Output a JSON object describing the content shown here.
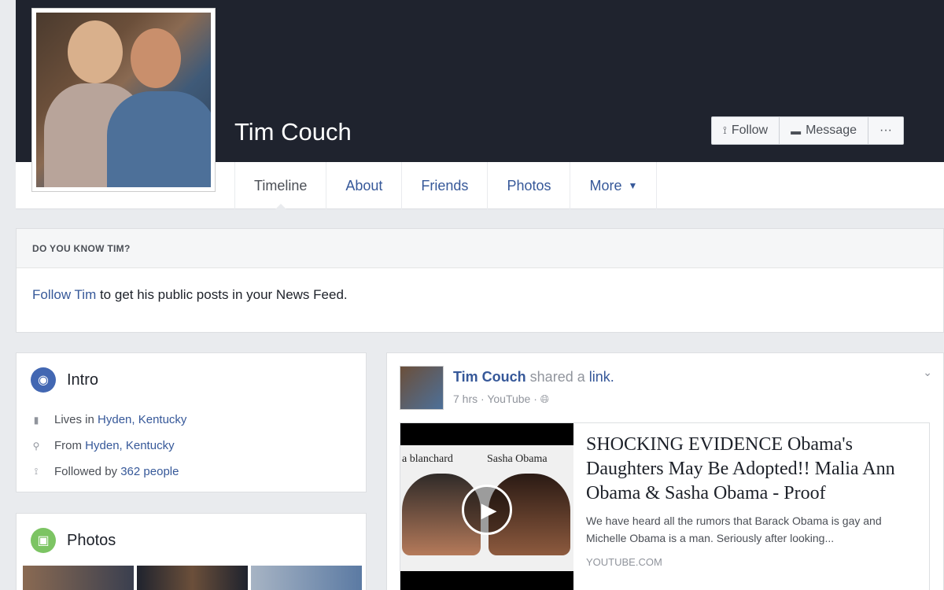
{
  "profile": {
    "name": "Tim Couch"
  },
  "cover_actions": {
    "follow": "Follow",
    "message": "Message",
    "more": "···"
  },
  "nav_tabs": [
    {
      "label": "Timeline"
    },
    {
      "label": "About"
    },
    {
      "label": "Friends"
    },
    {
      "label": "Photos"
    },
    {
      "label": "More"
    }
  ],
  "know_box": {
    "heading": "DO YOU KNOW TIM?",
    "follow_link": "Follow Tim",
    "text": " to get his public posts in your News Feed."
  },
  "intro": {
    "title": "Intro",
    "lives_prefix": "Lives in ",
    "lives_place": "Hyden, Kentucky",
    "from_prefix": "From ",
    "from_place": "Hyden, Kentucky",
    "followed_prefix": "Followed by ",
    "followed_count": "362 people"
  },
  "photos_card": {
    "title": "Photos"
  },
  "post": {
    "author": "Tim Couch",
    "action": " shared a ",
    "object": "link.",
    "time": "7 hrs",
    "separator": " · ",
    "source": "YouTube",
    "separator2": " · ",
    "link_title": "SHOCKING EVIDENCE Obama's Daughters May Be Adopted!! Malia Ann Obama & Sasha Obama - Proof",
    "link_desc": "We have heard all the rumors that Barack Obama is gay and Michelle Obama is a man. Seriously after looking...",
    "link_domain": "YOUTUBE.COM",
    "video_caption_left": "a blanchard",
    "video_caption_right": "Sasha Obama"
  },
  "colors": {
    "accent": "#365899",
    "cover": "#1f232e",
    "background": "#e9ebee"
  }
}
